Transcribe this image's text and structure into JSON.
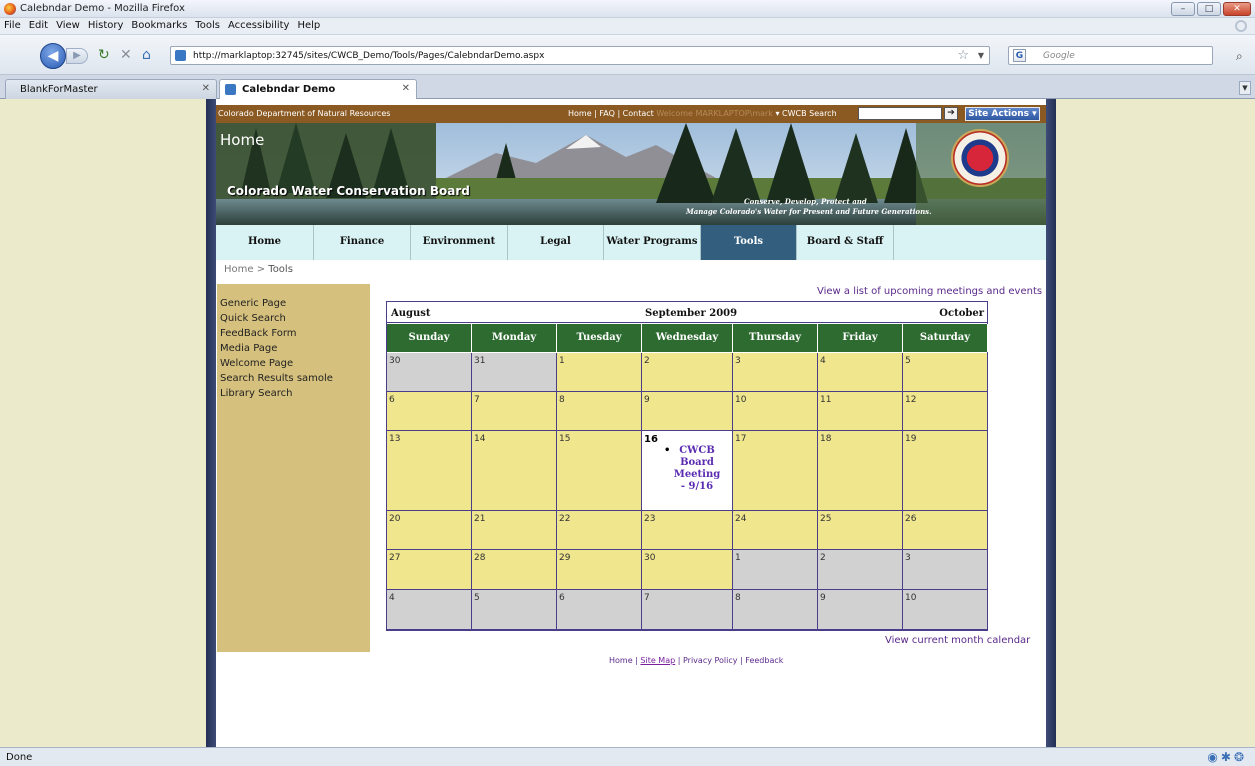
{
  "window": {
    "title": "Calebndar Demo - Mozilla Firefox",
    "min_icon": "minimize-icon",
    "max_icon": "maximize-icon",
    "close_icon": "close-icon"
  },
  "menu": [
    "File",
    "Edit",
    "View",
    "History",
    "Bookmarks",
    "Tools",
    "Accessibility",
    "Help"
  ],
  "nav": {
    "url": "http://marklaptop:32745/sites/CWCB_Demo/Tools/Pages/CalebndarDemo.aspx",
    "search_placeholder": "Google"
  },
  "tabs": [
    {
      "label": "BlankForMaster"
    },
    {
      "label": "Calebndar Demo"
    }
  ],
  "site": {
    "org": "Colorado Department of Natural Resources",
    "toplinks": "Home  |  FAQ  |  Contact",
    "welcome": "Welcome MARKLAPTOP\\mark",
    "search_label": "CWCB Search",
    "site_actions": "Site Actions",
    "page_title": "Home",
    "board_name": "Colorado Water Conservation Board",
    "tagline1": "Conserve, Develop, Protect and",
    "tagline2": "Manage Colorado's Water for Present and Future Generations."
  },
  "topnav": [
    {
      "label": "Home",
      "active": false
    },
    {
      "label": "Finance",
      "active": false
    },
    {
      "label": "Environment",
      "active": false
    },
    {
      "label": "Legal",
      "active": false
    },
    {
      "label": "Water Programs",
      "active": false
    },
    {
      "label": "Tools",
      "active": true
    },
    {
      "label": "Board & Staff",
      "active": false
    }
  ],
  "breadcrumb": {
    "home": "Home",
    "sep": " > ",
    "current": "Tools"
  },
  "sidebar": [
    "Generic Page",
    "Quick Search",
    "FeedBack Form",
    "Media Page",
    "Welcome Page",
    "Search Results samole",
    "Library Search"
  ],
  "links": {
    "view_list": "View a list of upcoming meetings and events",
    "view_current": "View current month calendar"
  },
  "calendar": {
    "prev": "August",
    "current": "September 2009",
    "next": "October",
    "days": [
      "Sunday",
      "Monday",
      "Tuesday",
      "Wednesday",
      "Thursday",
      "Friday",
      "Saturday"
    ],
    "weeks": [
      [
        {
          "d": "30",
          "t": "g"
        },
        {
          "d": "31",
          "t": "g"
        },
        {
          "d": "1",
          "t": "y"
        },
        {
          "d": "2",
          "t": "y"
        },
        {
          "d": "3",
          "t": "y"
        },
        {
          "d": "4",
          "t": "y"
        },
        {
          "d": "5",
          "t": "y"
        }
      ],
      [
        {
          "d": "6",
          "t": "y"
        },
        {
          "d": "7",
          "t": "y"
        },
        {
          "d": "8",
          "t": "y"
        },
        {
          "d": "9",
          "t": "y"
        },
        {
          "d": "10",
          "t": "y"
        },
        {
          "d": "11",
          "t": "y"
        },
        {
          "d": "12",
          "t": "y"
        }
      ],
      [
        {
          "d": "13",
          "t": "y"
        },
        {
          "d": "14",
          "t": "y"
        },
        {
          "d": "15",
          "t": "y"
        },
        {
          "d": "16",
          "t": "today",
          "event": "CWCB Board Meeting - 9/16"
        },
        {
          "d": "17",
          "t": "y"
        },
        {
          "d": "18",
          "t": "y"
        },
        {
          "d": "19",
          "t": "y"
        }
      ],
      [
        {
          "d": "20",
          "t": "y"
        },
        {
          "d": "21",
          "t": "y"
        },
        {
          "d": "22",
          "t": "y"
        },
        {
          "d": "23",
          "t": "y"
        },
        {
          "d": "24",
          "t": "y"
        },
        {
          "d": "25",
          "t": "y"
        },
        {
          "d": "26",
          "t": "y"
        }
      ],
      [
        {
          "d": "27",
          "t": "y"
        },
        {
          "d": "28",
          "t": "y"
        },
        {
          "d": "29",
          "t": "y"
        },
        {
          "d": "30",
          "t": "y"
        },
        {
          "d": "1",
          "t": "g"
        },
        {
          "d": "2",
          "t": "g"
        },
        {
          "d": "3",
          "t": "g"
        }
      ],
      [
        {
          "d": "4",
          "t": "g"
        },
        {
          "d": "5",
          "t": "g"
        },
        {
          "d": "6",
          "t": "g"
        },
        {
          "d": "7",
          "t": "g"
        },
        {
          "d": "8",
          "t": "g"
        },
        {
          "d": "9",
          "t": "g"
        },
        {
          "d": "10",
          "t": "g"
        }
      ]
    ]
  },
  "footer": {
    "home": "Home",
    "sitemap": "Site Map",
    "privacy": "Privacy Policy",
    "feedback": "Feedback"
  },
  "status": "Done",
  "colors": {
    "nav_active": "#335e7e",
    "day_header": "#2d6b31",
    "cell_month": "#efe68e",
    "cell_other": "#d1d1d1",
    "sidebar": "#d5c07d",
    "topbar": "#8b5a23"
  }
}
